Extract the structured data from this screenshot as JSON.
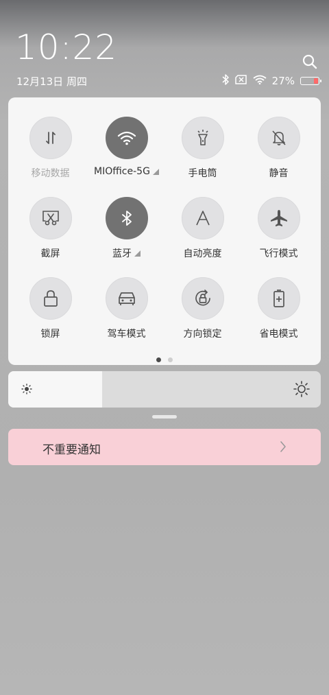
{
  "status": {
    "time": "10:22",
    "date": "12月13日 周四",
    "battery_percent": "27%",
    "battery_level": 0.27,
    "battery_color": "#ff6a6a"
  },
  "icons": {
    "search": "search-icon",
    "bluetooth_status": "bluetooth-icon",
    "sim": "no-sim-icon",
    "wifi_status": "wifi-icon",
    "battery": "battery-icon"
  },
  "tiles": [
    {
      "label": "移动数据",
      "icon": "mobile-data-icon",
      "active": false,
      "dim": true
    },
    {
      "label": "MIOffice-5G",
      "icon": "wifi-icon",
      "active": true,
      "has_menu": true
    },
    {
      "label": "手电筒",
      "icon": "flashlight-icon",
      "active": false
    },
    {
      "label": "静音",
      "icon": "mute-bell-icon",
      "active": false
    },
    {
      "label": "截屏",
      "icon": "screenshot-icon",
      "active": false
    },
    {
      "label": "蓝牙",
      "icon": "bluetooth-icon",
      "active": true,
      "has_menu": true
    },
    {
      "label": "自动亮度",
      "icon": "auto-brightness-icon",
      "active": false
    },
    {
      "label": "飞行模式",
      "icon": "airplane-icon",
      "active": false
    },
    {
      "label": "锁屏",
      "icon": "lock-icon",
      "active": false
    },
    {
      "label": "驾车模式",
      "icon": "car-icon",
      "active": false
    },
    {
      "label": "方向锁定",
      "icon": "rotation-lock-icon",
      "active": false
    },
    {
      "label": "省电模式",
      "icon": "battery-saver-icon",
      "active": false
    }
  ],
  "pager": {
    "pages": 2,
    "current": 1
  },
  "brightness": {
    "level": 0.3
  },
  "notification": {
    "label": "不重要通知"
  },
  "colors": {
    "active_tile": "#727272",
    "inactive_tile": "#e1e1e3",
    "notice_bg": "#f9d0d7"
  }
}
